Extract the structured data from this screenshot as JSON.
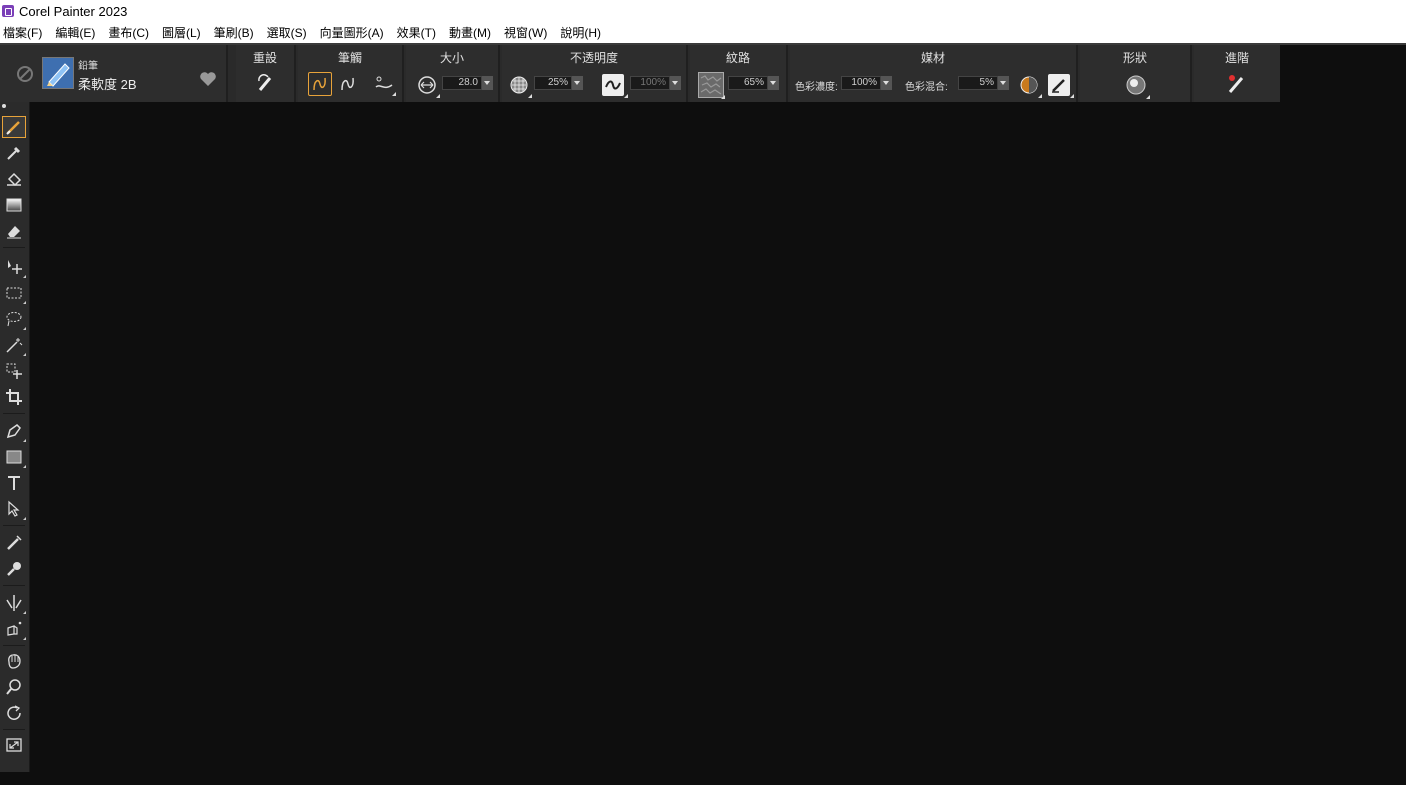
{
  "window": {
    "title": "Corel Painter 2023"
  },
  "menu": [
    "檔案(F)",
    "編輯(E)",
    "畫布(C)",
    "圖層(L)",
    "筆刷(B)",
    "選取(S)",
    "向量圖形(A)",
    "效果(T)",
    "動畫(M)",
    "視窗(W)",
    "說明(H)"
  ],
  "brush": {
    "category": "鉛筆",
    "variant": "柔軟度 2B"
  },
  "sections": {
    "reset": "重設",
    "stroke": "筆觸",
    "size": "大小",
    "opacity": "不透明度",
    "grain": "紋路",
    "media": "媒材",
    "shape": "形狀",
    "advanced": "進階"
  },
  "values": {
    "size": "28.0",
    "opacity": "25%",
    "opacity_expression": "100%",
    "grain": "65%",
    "resaturation": "100%",
    "bleed": "5%"
  },
  "labels": {
    "resaturation": "色彩濃度:",
    "bleed": "色彩混合:"
  },
  "colors": {
    "accent": "#e8a33a",
    "panel": "#2d2d2d",
    "canvas": "#0e0e0e"
  },
  "tools": [
    "brush-tool",
    "dropper-tool",
    "paint-bucket-tool",
    "gradient-tool",
    "eraser-tool",
    "layer-adjuster-tool",
    "rectangular-selection-tool",
    "lasso-tool",
    "magic-wand-tool",
    "transform-tool",
    "crop-tool",
    "pen-tool",
    "shape-tool",
    "text-tool",
    "shape-selection-tool",
    "cloner-tool",
    "rubber-stamp-tool",
    "mirror-painting-tool",
    "perspective-guides-tool",
    "grabber-tool",
    "magnifier-tool",
    "rotate-page-tool",
    "fit-to-screen-tool"
  ]
}
